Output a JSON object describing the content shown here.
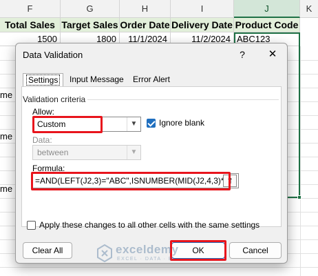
{
  "sheet": {
    "columns": [
      "F",
      "G",
      "H",
      "I",
      "J",
      "K"
    ],
    "headers": [
      "Total Sales",
      "Target Sales",
      "Order Date",
      "Delivery Date",
      "Product Code"
    ],
    "row1": [
      "1500",
      "1800",
      "11/1/2024",
      "11/2/2024",
      "ABC123"
    ],
    "edge_fragments": [
      "me",
      "me",
      "me"
    ]
  },
  "dialog": {
    "title": "Data Validation",
    "help": "?",
    "close": "✕",
    "tabs": [
      "Settings",
      "Input Message",
      "Error Alert"
    ],
    "active_tab": "Settings",
    "group_label": "Validation criteria",
    "allow_label": "Allow:",
    "allow_value": "Custom",
    "ignore_blank_label": "Ignore blank",
    "ignore_blank_checked": true,
    "data_label": "Data:",
    "data_value": "between",
    "formula_label": "Formula:",
    "formula_value": "=AND(LEFT(J2,3)=\"ABC\",ISNUMBER(MID(J2,4,3)*1",
    "apply_all_label": "Apply these changes to all other cells with the same settings",
    "apply_all_checked": false,
    "clear_all_label": "Clear All",
    "ok_label": "OK",
    "cancel_label": "Cancel"
  },
  "icons": {
    "dropdown": "chevron-down-icon",
    "ref_picker": "upload-arrow-icon"
  },
  "watermark": {
    "name": "exceldemy",
    "tagline": "EXCEL · DATA · BI"
  },
  "colors": {
    "selection_green": "#1e7145",
    "header_fill": "#e2efda",
    "highlight_red": "#e8141c",
    "checkbox_blue": "#1f6fbf"
  }
}
